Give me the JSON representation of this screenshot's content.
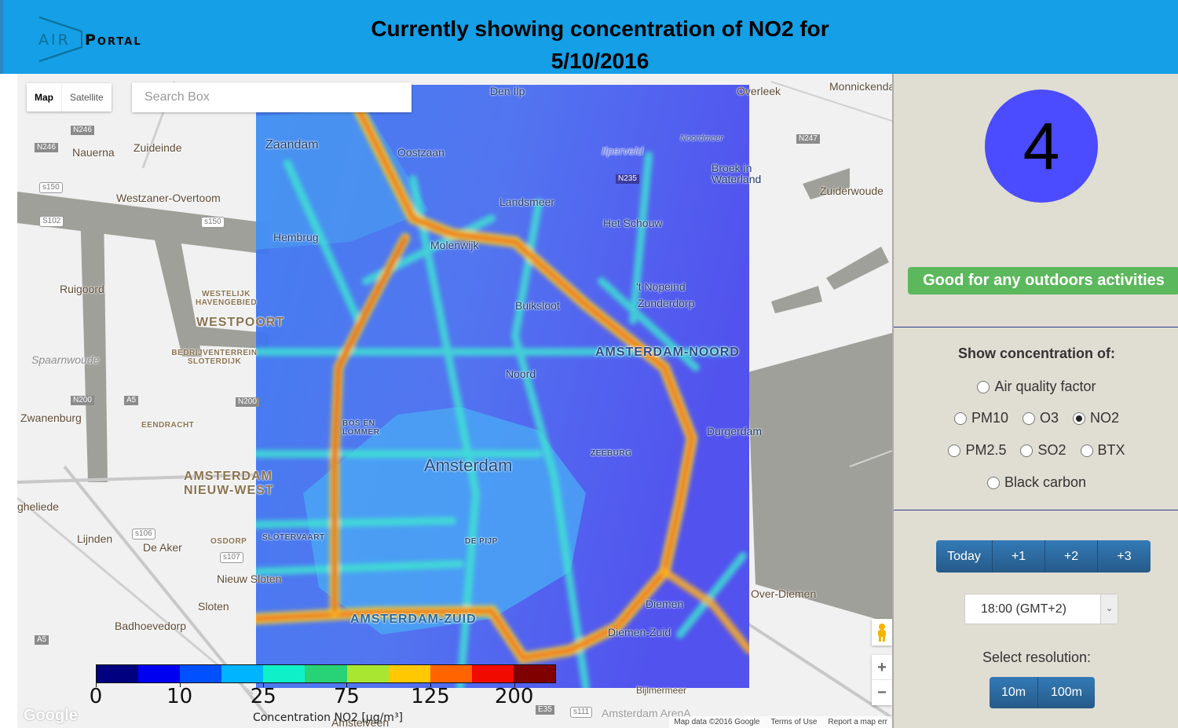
{
  "header": {
    "logo_air": "AIR",
    "logo_portal": "Portal",
    "title_line1": "Currently showing concentration of NO2 for",
    "title_line2": "5/10/2016"
  },
  "map": {
    "map_type": {
      "map_label": "Map",
      "satellite_label": "Satellite",
      "selected": "Map"
    },
    "search": {
      "placeholder": "Search Box",
      "value": ""
    },
    "labels": {
      "zaandam": "Zaandam",
      "oostzaan": "Oostzaan",
      "den_ilp": "Den Ilp",
      "overleek": "Overleek",
      "monnickendam": "Monnickenda",
      "nauerna": "Nauerna",
      "zuideinde": "Zuideinde",
      "westzaner": "Westzaner-Overtoom",
      "ruigoord": "Ruigoord",
      "westelijk": "WESTELIJK HAVENGEBIED",
      "westpoort": "WESTPOORT",
      "sloterdijk": "BEDRIJVENTERREIN SLOTERDIJK",
      "spaarnwoude": "Spaarnwoude",
      "zwanenburg": "Zwanenburg",
      "eendracht": "EENDRACHT",
      "nieuw_west": "AMSTERDAM NIEUW-WEST",
      "halfweg": "gheliede",
      "lijnden": "Lijnden",
      "de_aker": "De Aker",
      "osdorp": "OSDORP",
      "nieuw_sloten": "Nieuw Sloten",
      "sloten": "Sloten",
      "badhoevedorp": "Badhoevedorp",
      "hembrug": "Hembrug",
      "molenwijk": "Molenwijk",
      "landsmeer": "Landsmeer",
      "het_schouw": "Het Schouw",
      "nopeind": "'t Nopeind",
      "zunderdorp": "Zunderdorp",
      "buiksloot": "Buiksloot",
      "amsterdam_noord": "AMSTERDAM-NOORD",
      "noord": "Noord",
      "amsterdam": "Amsterdam",
      "durgerdam": "Durgerdam",
      "zuiderwoude": "Zuiderwoude",
      "broek": "Broek in Waterland",
      "noordmeer": "Noordmeer",
      "ilperveld": "Ilperveld",
      "amsterdam_zuid": "AMSTERDAM-ZUID",
      "diemen": "Diemen",
      "diemen_zuid": "Diemen-Zuid",
      "over_diemen": "Over-Diemen",
      "bijlmermeer": "Bijlmermeer",
      "arena": "Amsterdam ArenA",
      "amstelveen": "Amstelveen",
      "slotervaart": "SLOTERVAART",
      "de_pijp": "DE PIJP",
      "zeeburg": "ZEEBURG",
      "bos_en_lommer": "BOS EN LOMMER"
    },
    "shields": [
      "N246",
      "N246",
      "s150",
      "S102",
      "s150",
      "N200",
      "A5",
      "N200",
      "s106",
      "s107",
      "A5",
      "N247",
      "N235",
      "E35",
      "s111"
    ],
    "google_logo": "Google",
    "attribution": {
      "map_data": "Map data ©2016 Google",
      "terms": "Terms of Use",
      "report": "Report a map err"
    },
    "zoom_in": "+",
    "zoom_out": "−"
  },
  "colorbar": {
    "label": "Concentration NO2 [µg/m³]",
    "colors": [
      "#000080",
      "#0000f0",
      "#0050ff",
      "#00b4ff",
      "#10f0c8",
      "#28d277",
      "#a8e632",
      "#ffc800",
      "#ff6400",
      "#f00a00",
      "#800000"
    ],
    "ticks": [
      {
        "label": "0",
        "pos": 0
      },
      {
        "label": "10",
        "pos": 0.182
      },
      {
        "label": "25",
        "pos": 0.364
      },
      {
        "label": "75",
        "pos": 0.545
      },
      {
        "label": "125",
        "pos": 0.727
      },
      {
        "label": "200",
        "pos": 0.909
      }
    ]
  },
  "panel": {
    "aqi_value": "4",
    "aqi_color": "#4b4bff",
    "aqi_message": "Good for any outdoors activities",
    "concentration_title": "Show concentration of:",
    "pollutants": {
      "air_quality_factor": "Air quality factor",
      "pm10": "PM10",
      "o3": "O3",
      "no2": "NO2",
      "pm25": "PM2.5",
      "so2": "SO2",
      "btx": "BTX",
      "black_carbon": "Black carbon"
    },
    "selected_pollutant": "NO2",
    "days": [
      "Today",
      "+1",
      "+2",
      "+3"
    ],
    "time_value": "18:00 (GMT+2)",
    "resolution_title": "Select resolution:",
    "resolutions": [
      "10m",
      "100m"
    ]
  }
}
